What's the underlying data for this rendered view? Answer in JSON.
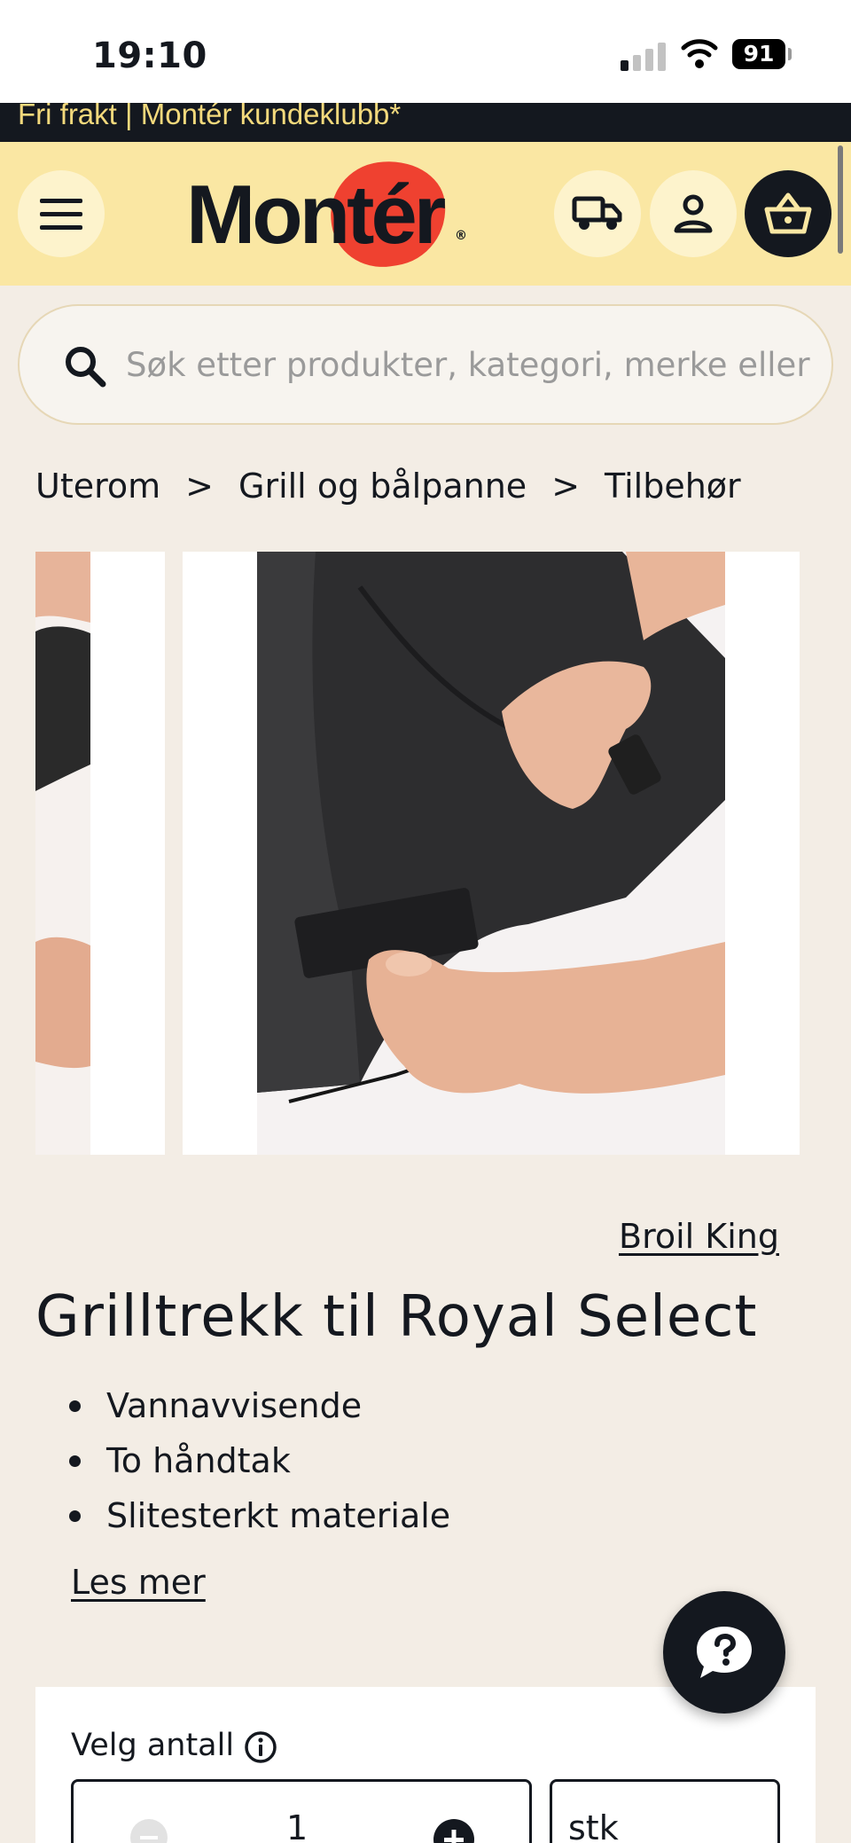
{
  "status_bar": {
    "time": "19:10",
    "battery": "91"
  },
  "promo": {
    "text": "Fri frakt | Montér kundeklubb*"
  },
  "header": {
    "logo_text": "Montér",
    "logo_registered": "®",
    "icons": [
      "menu-icon",
      "delivery-truck-icon",
      "account-icon",
      "basket-icon"
    ]
  },
  "search": {
    "placeholder": "Søk etter produkter, kategori, merke eller",
    "value": ""
  },
  "breadcrumb": {
    "items": [
      "Uterom",
      "Grill og bålpanne",
      "Tilbehør"
    ],
    "separator": ">"
  },
  "product": {
    "brand": "Broil King",
    "title": "Grilltrekk til Royal Select",
    "features": [
      "Vannavvisende",
      "To håndtak",
      "Slitesterkt materiale"
    ],
    "read_more": "Les mer"
  },
  "quantity": {
    "label": "Velg antall",
    "value": "1",
    "unit": "stk"
  },
  "colors": {
    "header_bg": "#fae7a3",
    "page_bg": "#f3ede5",
    "dark": "#14181f",
    "brand_red": "#ef4130",
    "promo_text": "#f3d97c"
  }
}
